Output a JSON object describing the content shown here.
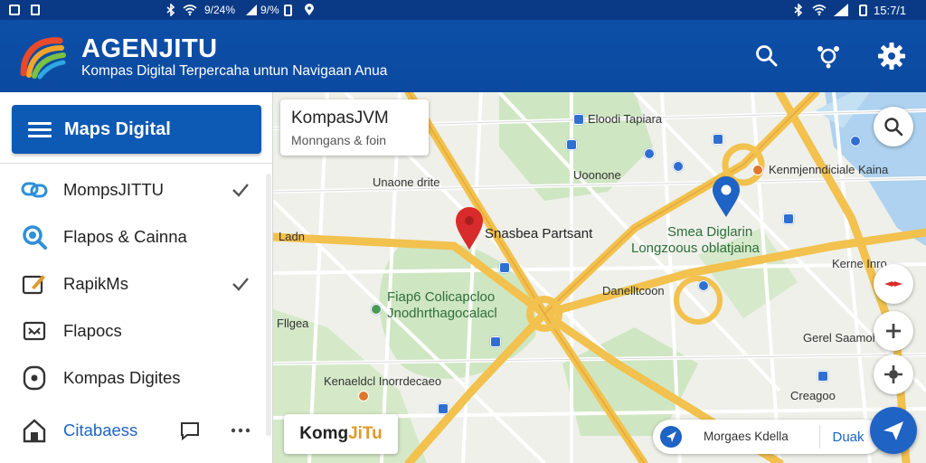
{
  "status_bar": {
    "left_text": "9/24%",
    "mid_text": "9/%",
    "time": "15:7/1"
  },
  "app": {
    "title": "AGENJITU",
    "subtitle": "Kompas Digital Terpercaha untun Navigaan Anua"
  },
  "toolbar": {
    "search_icon": "search-icon",
    "route_icon": "route-icon",
    "settings_icon": "gear-icon"
  },
  "sidebar": {
    "header_label": "Maps Digital",
    "items": [
      {
        "label": "MompsJITTU",
        "icon": "link-icon",
        "checked": true
      },
      {
        "label": "Flapos & Cainna",
        "icon": "magnifier-icon",
        "checked": false
      },
      {
        "label": "RapikMs",
        "icon": "edit-icon",
        "checked": true
      },
      {
        "label": "Flapocs",
        "icon": "mail-icon",
        "checked": false
      },
      {
        "label": "Kompas Digites",
        "icon": "target-icon",
        "checked": false
      }
    ],
    "footer": {
      "label": "Citabaess",
      "icon": "home-icon",
      "chat_icon": "chat-icon",
      "more_icon": "more-icon"
    }
  },
  "map": {
    "info_card": {
      "title": "KompasJVM",
      "subtitle": "Monngans & foin"
    },
    "labels": {
      "l1": "Eloodi Tapiara",
      "l2": "Uoonone",
      "l3": "Unaone drite",
      "l4": "Kenmjenndiciale Kaina",
      "l5": "Ladn",
      "l6": "Snasbea Partsant",
      "l7": "Smea Diglarin",
      "l8": "Longzoous oblatjaina",
      "l9": "Kerne Inro",
      "l10": "Fiap6 Colicapcloo",
      "l11": "Jnodhrthagocalacl",
      "l12": "Danelltcoon",
      "l13": "Fllgea",
      "l14": "Gerel Saamohr",
      "l15": "Kenaeldcl Inorrdecaeo",
      "l16": "Creagoo"
    },
    "brand": {
      "part1": "Komg",
      "part2": "J",
      "part3": "iTu"
    },
    "bottom_pill": {
      "text": "Morgaes Kdella",
      "button": "Duak"
    }
  },
  "colors": {
    "appbar": "#0d4ea7",
    "accent": "#1f63c4",
    "road_major": "#f2c14e",
    "park": "#cfe6c2",
    "water": "#aed2ef",
    "pin_red": "#d92b2b"
  }
}
